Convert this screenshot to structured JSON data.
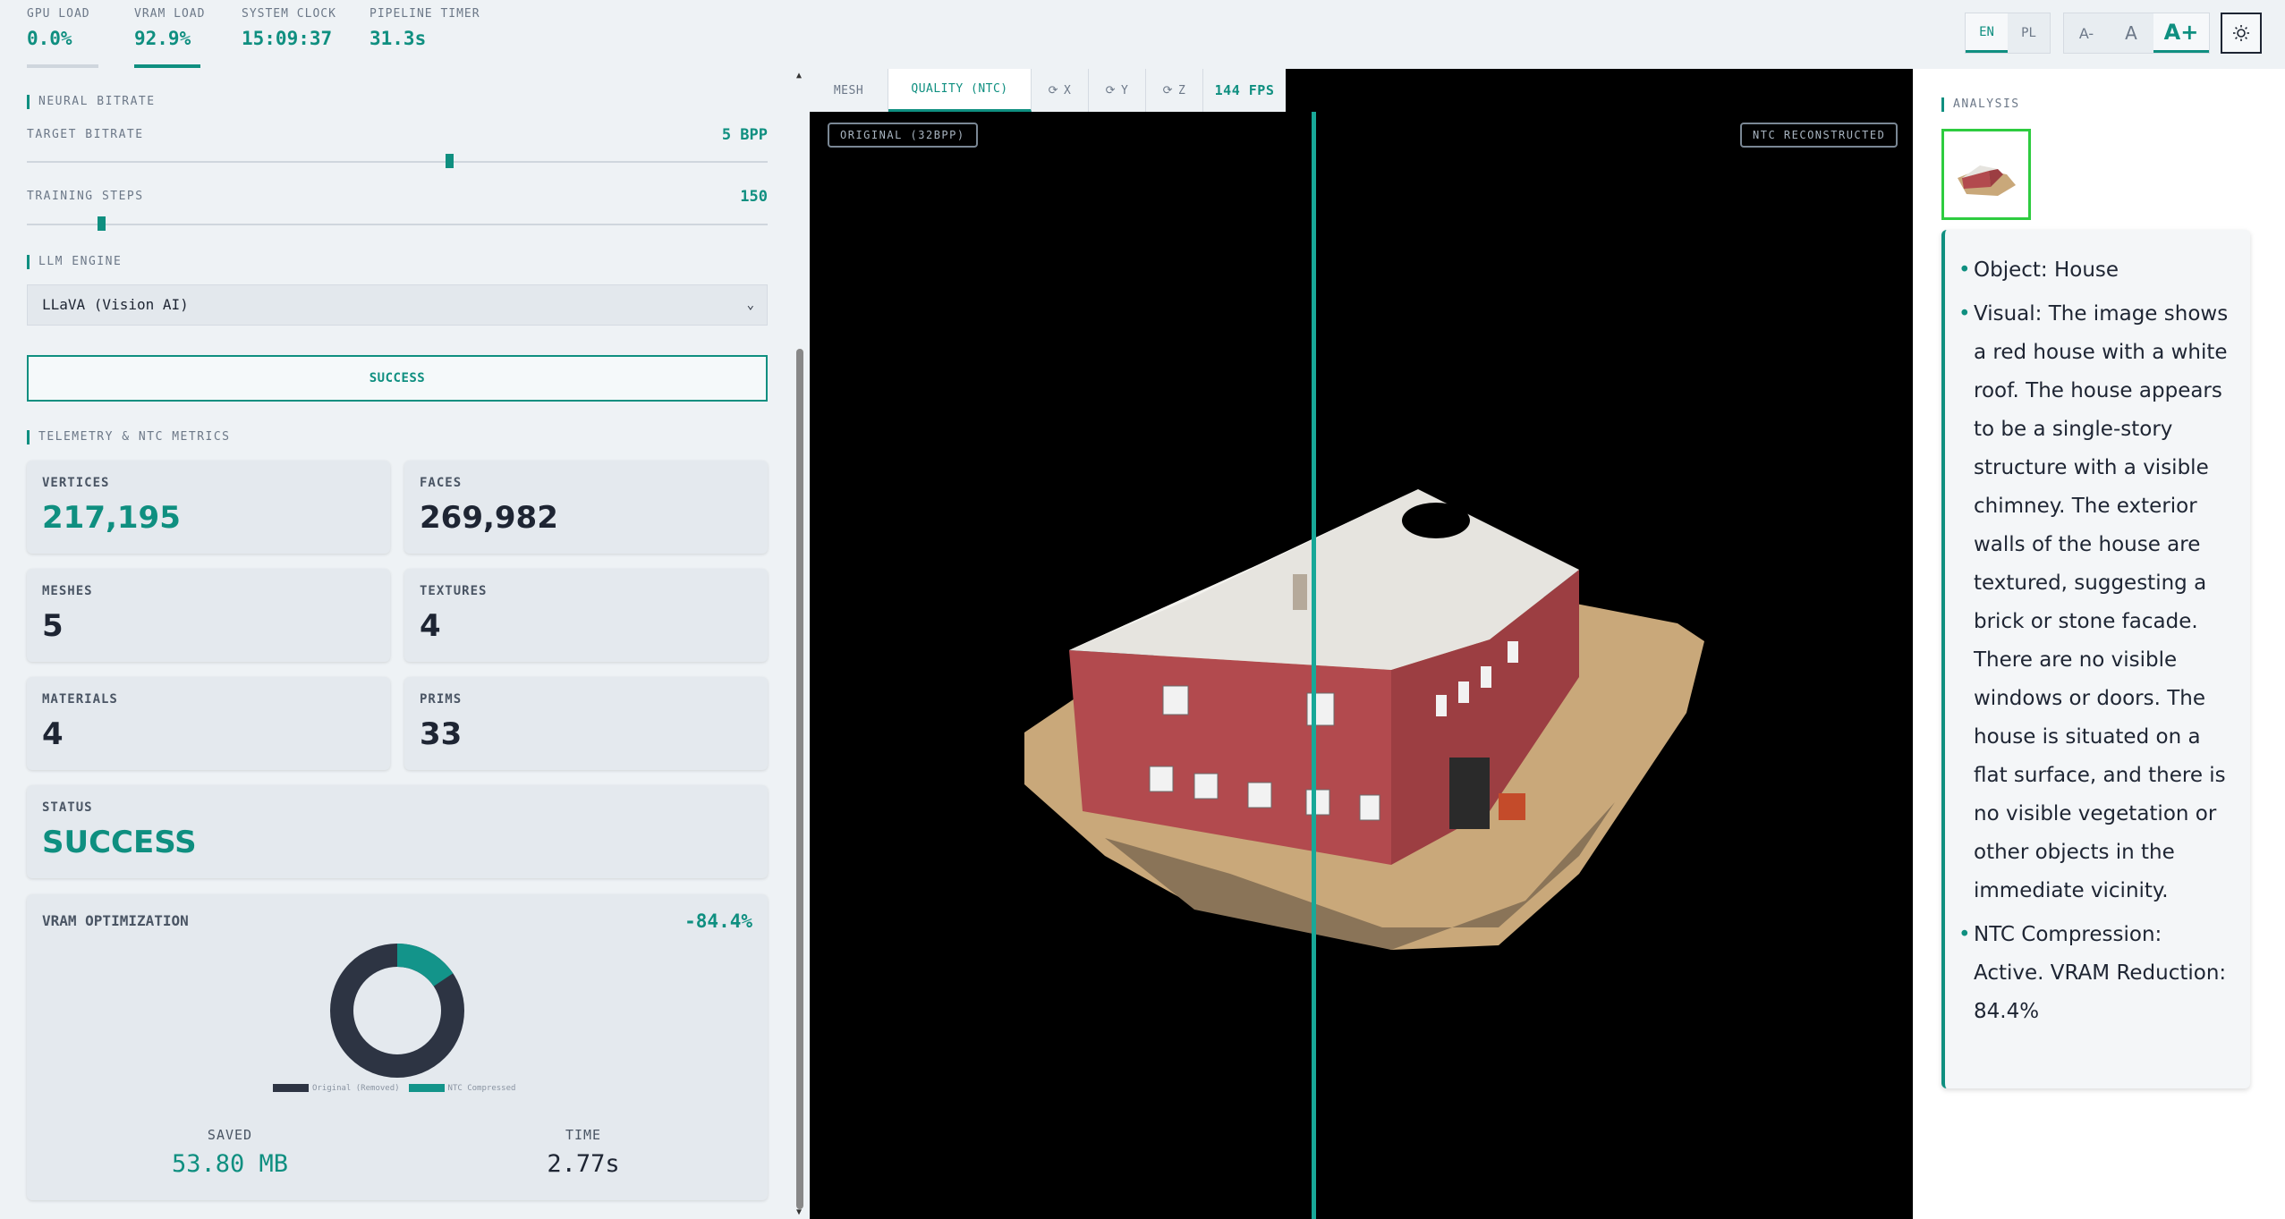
{
  "topbar": {
    "stats": [
      {
        "label": "GPU LOAD",
        "value": "0.0%"
      },
      {
        "label": "VRAM LOAD",
        "value": "92.9%"
      },
      {
        "label": "SYSTEM CLOCK",
        "value": "15:09:37"
      },
      {
        "label": "PIPELINE TIMER",
        "value": "31.3s"
      }
    ],
    "lang": {
      "en": "EN",
      "pl": "PL"
    },
    "font": {
      "smaller": "A-",
      "normal": "A",
      "larger": "A+"
    },
    "accent": "#0f8f80"
  },
  "left": {
    "neural_title": "NEURAL BITRATE",
    "bitrate_label": "TARGET BITRATE",
    "bitrate_value": "5 BPP",
    "bitrate_level": 0.57,
    "steps_label": "TRAINING STEPS",
    "steps_value": "150",
    "steps_level": 0.1,
    "llm_title": "LLM ENGINE",
    "llm_selected": "LLaVA (Vision AI)",
    "status_button": "SUCCESS",
    "telemetry_title": "TELEMETRY & NTC METRICS",
    "cards": {
      "vertices_label": "VERTICES",
      "vertices_value": "217,195",
      "faces_label": "FACES",
      "faces_value": "269,982",
      "meshes_label": "MESHES",
      "meshes_value": "5",
      "textures_label": "TEXTURES",
      "textures_value": "4",
      "materials_label": "MATERIALS",
      "materials_value": "4",
      "prims_label": "PRIMS",
      "prims_value": "33",
      "status_label": "STATUS",
      "status_value": "SUCCESS"
    },
    "vram": {
      "title": "VRAM OPTIMIZATION",
      "percent": "-84.4%",
      "legend_original": "Original (Removed)",
      "legend_ntc": "NTC Compressed",
      "removed_fraction": 0.844,
      "compressed_fraction": 0.156,
      "saved_label": "SAVED",
      "saved_value": "53.80 MB",
      "time_label": "TIME",
      "time_value": "2.77s",
      "color_removed": "#2d3443",
      "color_ntc": "#13948a"
    }
  },
  "viewport": {
    "tabs": {
      "mesh": "MESH",
      "quality": "QUALITY (NTC)",
      "x": "X",
      "y": "Y",
      "z": "Z",
      "fps": "144 FPS"
    },
    "tag_original": "ORIGINAL (32BPP)",
    "tag_reconstructed": "NTC RECONSTRUCTED"
  },
  "right": {
    "title": "ANALYSIS",
    "items": [
      "Object: House",
      "Visual: The image shows a red house with a white roof. The house appears to be a single-story structure with a visible chimney. The exterior walls of the house are textured, suggesting a brick or stone facade. There are no visible windows or doors. The house is situated on a flat surface, and there is no visible vegetation or other objects in the immediate vicinity.",
      "NTC Compression: Active. VRAM Reduction: 84.4%"
    ]
  }
}
